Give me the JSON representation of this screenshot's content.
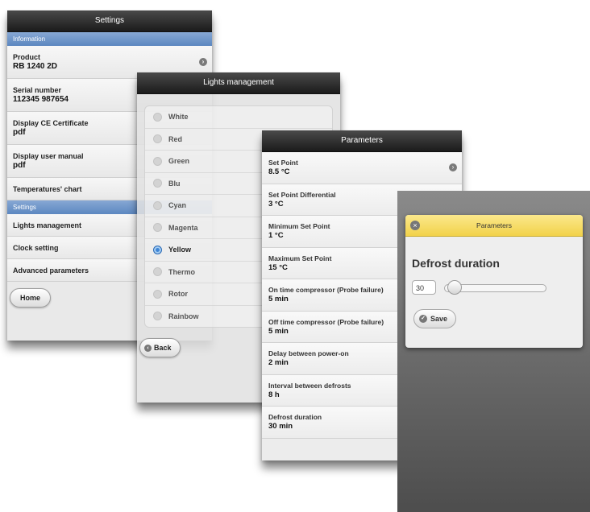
{
  "settings_screen": {
    "title": "Settings",
    "section_information": "Information",
    "product_label": "Product",
    "product_value": "RB 1240 2D",
    "serial_label": "Serial number",
    "serial_value": "112345 987654",
    "ce_label": "Display CE Certificate",
    "ce_value": "pdf",
    "manual_label": "Display user manual",
    "manual_value": "pdf",
    "temps_chart": "Temperatures' chart",
    "section_settings": "Settings",
    "lights_management": "Lights management",
    "clock_setting": "Clock setting",
    "advanced_parameters": "Advanced parameters",
    "home_button": "Home"
  },
  "lights_screen": {
    "title": "Lights management",
    "options": [
      "White",
      "Red",
      "Green",
      "Blu",
      "Cyan",
      "Magenta",
      "Yellow",
      "Thermo",
      "Rotor",
      "Rainbow"
    ],
    "selected": "Yellow",
    "back_button": "Back"
  },
  "parameters_screen": {
    "title": "Parameters",
    "items": [
      {
        "label": "Set Point",
        "value": "8.5 °C"
      },
      {
        "label": "Set Point Differential",
        "value": "3 °C"
      },
      {
        "label": "Minimum Set Point",
        "value": "1 °C"
      },
      {
        "label": "Maximum Set Point",
        "value": "15 °C"
      },
      {
        "label": "On time compressor (Probe failure)",
        "value": "5 min"
      },
      {
        "label": "Off time compressor (Probe failure)",
        "value": "5 min"
      },
      {
        "label": "Delay between power-on",
        "value": "2 min"
      },
      {
        "label": "Interval between defrosts",
        "value": "8 h"
      },
      {
        "label": "Defrost duration",
        "value": "30 min"
      }
    ]
  },
  "defrost_dialog": {
    "header": "Parameters",
    "title": "Defrost duration",
    "value": "30",
    "save_button": "Save",
    "slider_fraction": 0.05
  },
  "colors": {
    "header_dark": "#1b1b1b",
    "section_blue": "#5c87c0",
    "dialog_yellow": "#f2d24a",
    "selected_radio": "#3f86d6"
  }
}
